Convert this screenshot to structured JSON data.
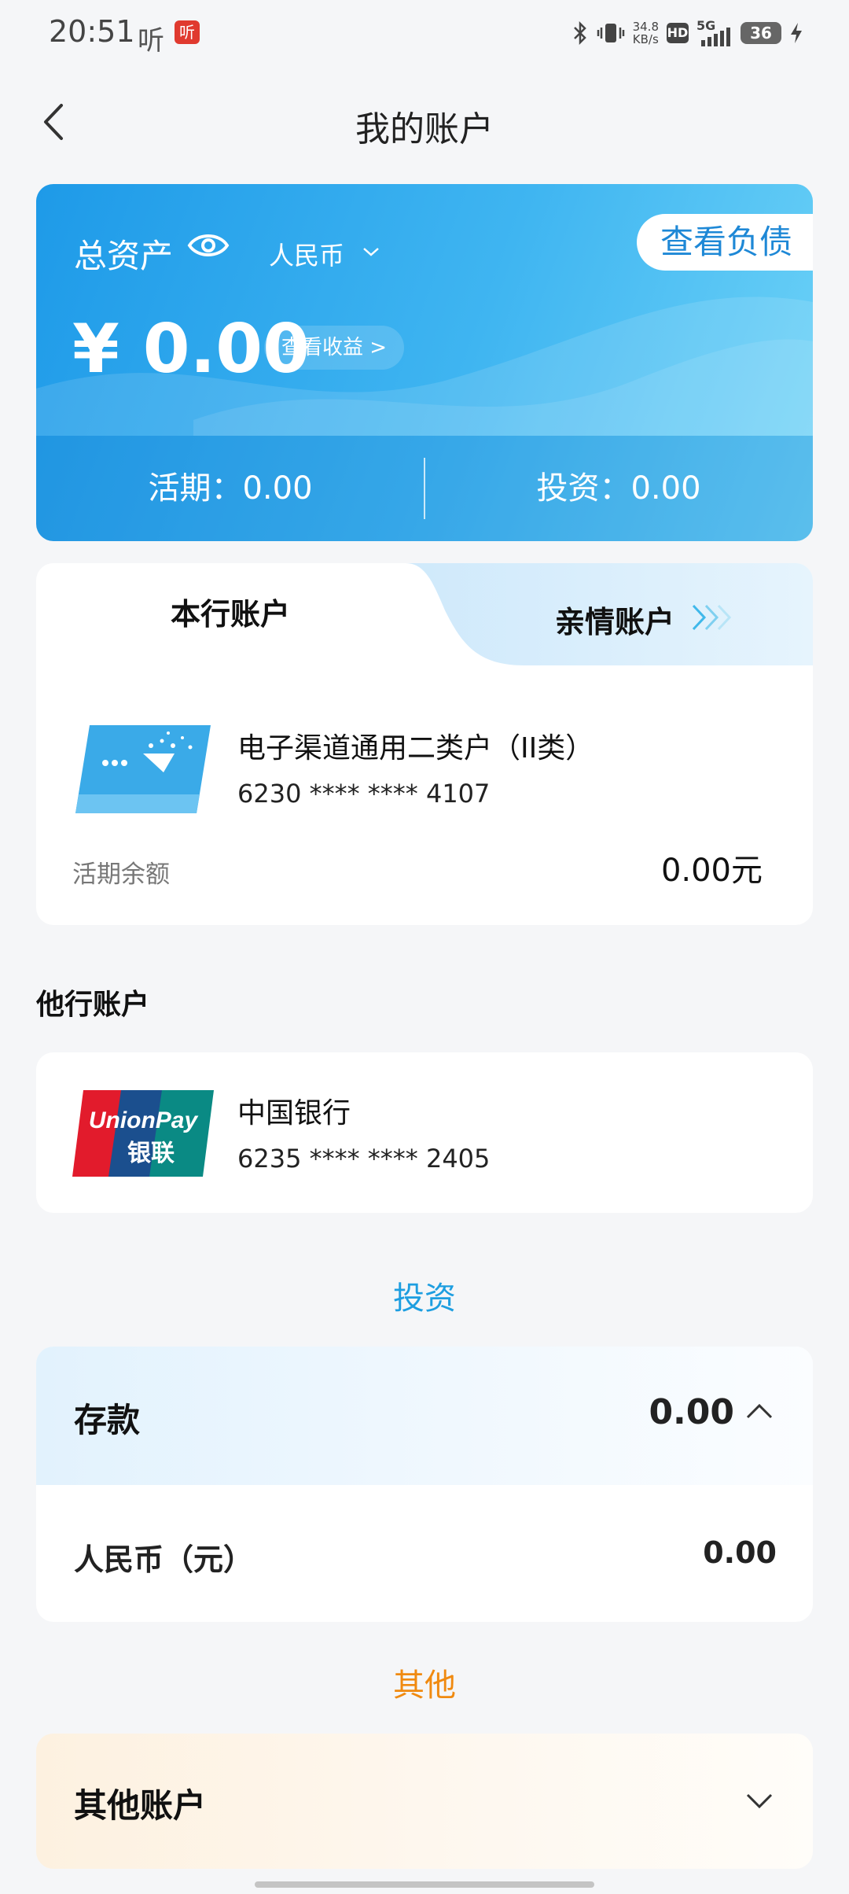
{
  "status_bar": {
    "time": "20:51",
    "app_icon_text": "听",
    "app_badge_text": "听",
    "net_speed_value": "34.8",
    "net_speed_unit": "KB/s",
    "hd": "HD",
    "network": "5G",
    "battery": "36"
  },
  "header": {
    "title": "我的账户"
  },
  "asset_card": {
    "label": "总资产",
    "currency": "人民币",
    "debt_button": "查看负债",
    "amount": "¥ 0.00",
    "income_button": "查看收益 >",
    "current": "活期：0.00",
    "investment": "投资：0.00"
  },
  "tabs": {
    "own": "本行账户",
    "family": "亲情账户"
  },
  "own_account": {
    "name": "电子渠道通用二类户（II类）",
    "number": "6230 **** **** 4107",
    "balance_label": "活期余额",
    "balance_value": "0.00元"
  },
  "other_bank_section": {
    "title": "他行账户"
  },
  "other_bank": {
    "name": "中国银行",
    "number": "6235 **** **** 2405",
    "logo_text_top": "UnionPay",
    "logo_text_bottom": "银联"
  },
  "invest_section": {
    "title": "投资"
  },
  "deposit": {
    "label": "存款",
    "value": "0.00",
    "row_label": "人民币（元）",
    "row_value": "0.00"
  },
  "other_section": {
    "title": "其他"
  },
  "other_account": {
    "label": "其他账户"
  },
  "colors": {
    "brand_blue": "#1e9ae8",
    "invest_blue": "#1d9ee0",
    "other_orange": "#f08a10"
  }
}
